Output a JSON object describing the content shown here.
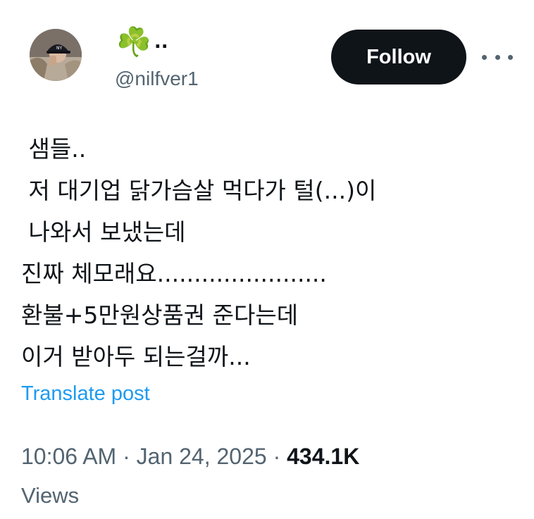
{
  "author": {
    "display_name_emoji": "☘️",
    "display_name_text": "..",
    "handle": "@nilfver1",
    "avatar_icon": "profile-photo"
  },
  "actions": {
    "follow_label": "Follow",
    "more_icon": "more-dots-icon"
  },
  "tweet": {
    "lines": [
      " 샘들..",
      " 저 대기업 닭가슴살 먹다가 털(...)이",
      " 나와서 보냈는데",
      "진짜 체모래요.......................",
      "환불+5만원상품권 준다는데",
      "이거 받아두 되는걸까..."
    ]
  },
  "translate_label": "Translate post",
  "meta": {
    "time": "10:06 AM",
    "separator": " · ",
    "date": "Jan 24, 2025",
    "views_count": "434.1K",
    "views_label": "Views"
  },
  "colors": {
    "text": "#0f1419",
    "secondary": "#536471",
    "link": "#1d9bf0",
    "button_bg": "#0f1419"
  }
}
